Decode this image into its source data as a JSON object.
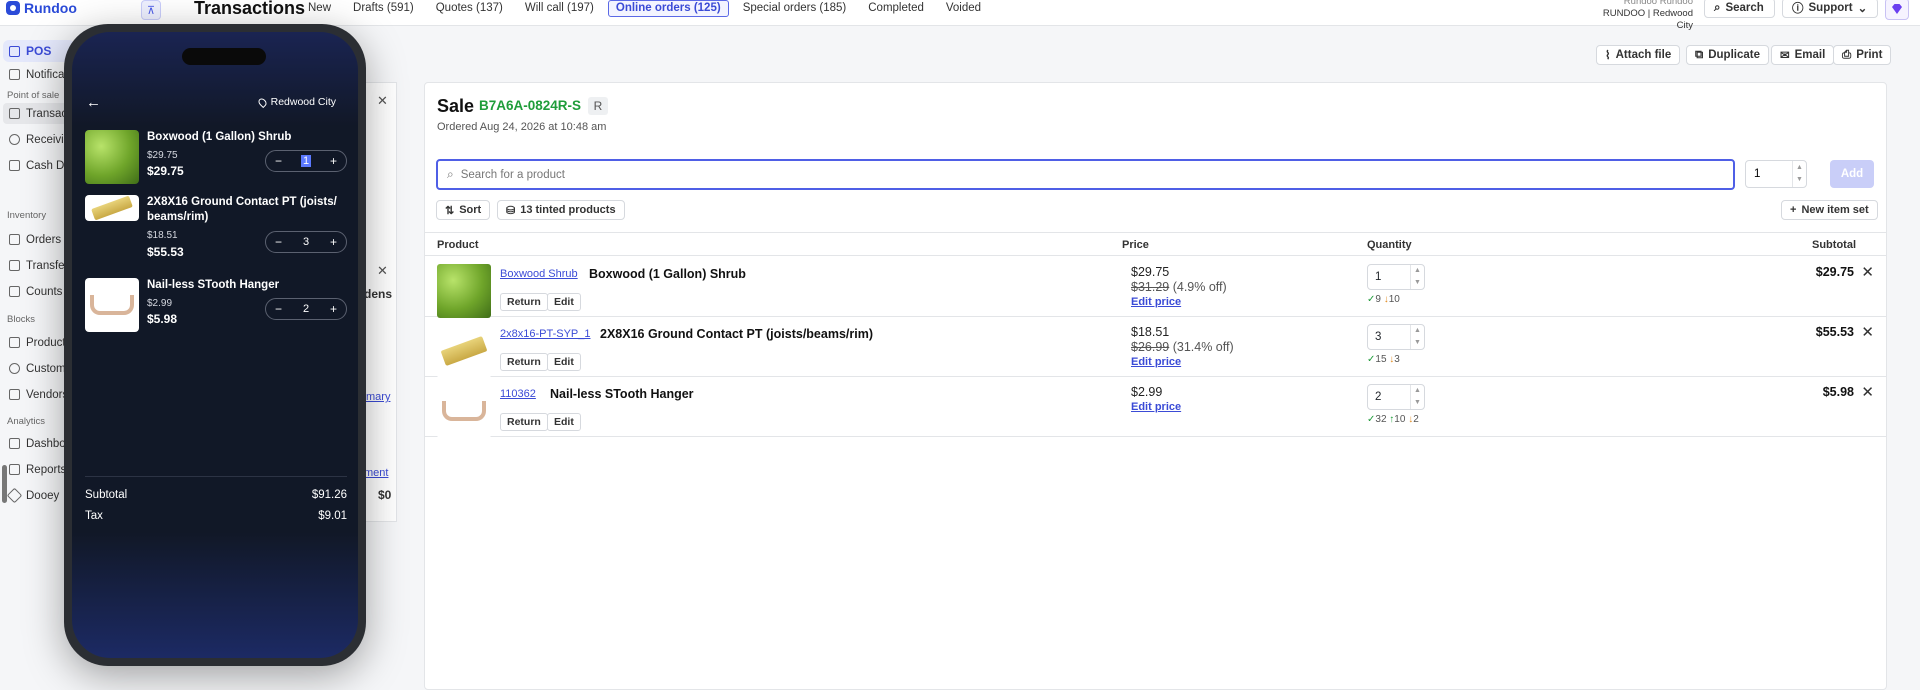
{
  "app": {
    "brand": "Rundoo",
    "title": "Transactions"
  },
  "tabs": [
    "New",
    "Drafts (591)",
    "Quotes (137)",
    "Will call (197)",
    "Online orders (125)",
    "Special orders (185)",
    "Completed",
    "Voided"
  ],
  "store": {
    "top": "Rundoo Rundoo",
    "name": "RUNDOO | Redwood City"
  },
  "header_buttons": {
    "search": "Search",
    "support": "Support"
  },
  "sidebar": {
    "pos": "POS",
    "notifications": "Notifications",
    "sec_pos": "Point of sale",
    "transactions": "Transactions",
    "receiving": "Receiving",
    "cash_drawer": "Cash Drawer",
    "sec_inventory": "Inventory",
    "orders": "Orders",
    "transfers": "Transfers",
    "counts": "Counts",
    "sec_blocks": "Blocks",
    "products": "Products",
    "customers": "Customers",
    "vendors": "Vendors",
    "sec_analytics": "Analytics",
    "dashboards": "Dashboards",
    "reports": "Reports",
    "dooey": "Dooey"
  },
  "middle_panel": {
    "text1": "dens",
    "link1": "mary",
    "link2": "ment",
    "amount": "$0"
  },
  "actions": {
    "attach": "Attach file",
    "duplicate": "Duplicate",
    "email": "Email",
    "print": "Print"
  },
  "sale": {
    "title": "Sale",
    "id": "B7A6A-0824R-S",
    "badge": "R",
    "ordered": "Ordered Aug 24, 2026 at 10:48 am",
    "search_placeholder": "Search for a product",
    "qty": "1",
    "add": "Add",
    "sort": "Sort",
    "tinted": "13 tinted products",
    "new_item_set": "New item set"
  },
  "table": {
    "headers": {
      "product": "Product",
      "price": "Price",
      "quantity": "Quantity",
      "subtotal": "Subtotal"
    },
    "return_label": "Return",
    "edit_label": "Edit",
    "edit_price": "Edit price",
    "rows": [
      {
        "sku": "Boxwood Shrub",
        "name": "Boxwood (1 Gallon) Shrub",
        "price": "$29.75",
        "orig": "$31.29",
        "off": "(4.9% off)",
        "qty": "1",
        "s1": "9",
        "s2": "10",
        "s3": "",
        "subtotal": "$29.75"
      },
      {
        "sku": "2x8x16-PT-SYP_1",
        "name": "2X8X16 Ground Contact PT (joists/beams/rim)",
        "price": "$18.51",
        "orig": "$26.99",
        "off": "(31.4% off)",
        "qty": "3",
        "s1": "15",
        "s2": "3",
        "s3": "",
        "subtotal": "$55.53"
      },
      {
        "sku": "110362",
        "name": "Nail-less STooth Hanger",
        "price": "$2.99",
        "orig": "",
        "off": "",
        "qty": "2",
        "s1": "32",
        "s2": "10",
        "s3": "2",
        "subtotal": "$5.98"
      }
    ]
  },
  "phone": {
    "location": "Redwood City",
    "items": [
      {
        "name": "Boxwood (1 Gallon) Shrub",
        "unit": "$29.75",
        "total": "$29.75",
        "qty": "1"
      },
      {
        "name": "2X8X16 Ground Contact PT (joists/ beams/rim)",
        "unit": "$18.51",
        "total": "$55.53",
        "qty": "3"
      },
      {
        "name": "Nail-less STooth Hanger",
        "unit": "$2.99",
        "total": "$5.98",
        "qty": "2"
      }
    ],
    "subtotal_label": "Subtotal",
    "subtotal": "$91.26",
    "tax_label": "Tax",
    "tax": "$9.01"
  },
  "colors": {
    "accent": "#4f5fe6",
    "sale_id": "#1f9d3a",
    "phone_bg": "#111827"
  }
}
